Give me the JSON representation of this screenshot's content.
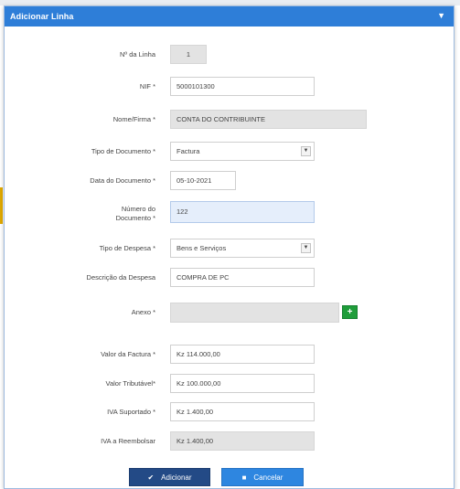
{
  "dialog": {
    "title": "Adicionar Linha",
    "close_icon": "▼"
  },
  "form": {
    "line_number": {
      "label": "Nº da Linha",
      "value": "1"
    },
    "nif": {
      "label": "NIF *",
      "value": "5000101300"
    },
    "name": {
      "label": "Nome/Firma *",
      "value": "CONTA DO CONTRIBUINTE"
    },
    "doc_type": {
      "label": "Tipo de Documento *",
      "value": "Factura"
    },
    "doc_date": {
      "label": "Data do Documento *",
      "value": "05-10-2021"
    },
    "doc_number": {
      "label": "Número do Documento *",
      "value": "122"
    },
    "expense_type": {
      "label": "Tipo de Despesa *",
      "value": "Bens e Serviços"
    },
    "expense_desc": {
      "label": "Descrição da Despesa",
      "value": "COMPRA DE PC"
    },
    "attachment": {
      "label": "Anexo *",
      "value": ""
    },
    "invoice_value": {
      "label": "Valor da Factura *",
      "value": "Kz 114.000,00"
    },
    "taxable_value": {
      "label": "Valor Tributável*",
      "value": "Kz 100.000,00"
    },
    "iva_supported": {
      "label": "IVA Suportado *",
      "value": "Kz 1.400,00"
    },
    "iva_refund": {
      "label": "IVA a Reembolsar",
      "value": "Kz 1.400,00"
    }
  },
  "buttons": {
    "add_label": "Adicionar",
    "cancel_label": "Cancelar"
  },
  "colors": {
    "titlebar": "#2e7ed8",
    "add_button": "#234a86",
    "cancel_button": "#2e86e0",
    "attach_button": "#1f9d3a"
  },
  "icons": {
    "add": "check-icon",
    "cancel": "square-icon",
    "attach": "plus-icon",
    "close": "chevron-down-icon"
  }
}
